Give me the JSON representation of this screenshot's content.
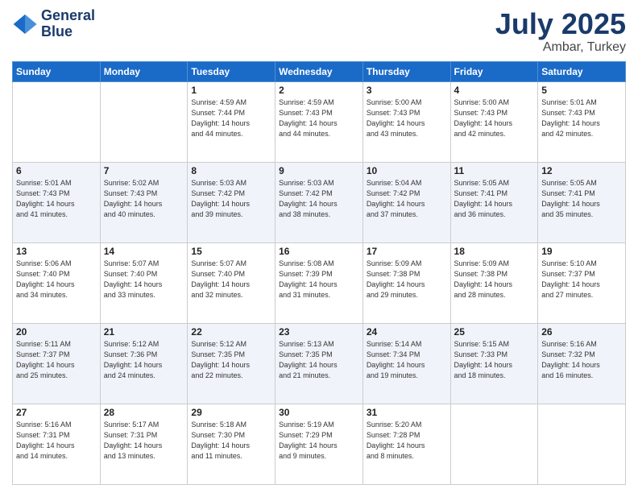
{
  "header": {
    "logo_line1": "General",
    "logo_line2": "Blue",
    "month": "July 2025",
    "location": "Ambar, Turkey"
  },
  "weekdays": [
    "Sunday",
    "Monday",
    "Tuesday",
    "Wednesday",
    "Thursday",
    "Friday",
    "Saturday"
  ],
  "weeks": [
    [
      {
        "day": "",
        "info": ""
      },
      {
        "day": "",
        "info": ""
      },
      {
        "day": "1",
        "info": "Sunrise: 4:59 AM\nSunset: 7:44 PM\nDaylight: 14 hours\nand 44 minutes."
      },
      {
        "day": "2",
        "info": "Sunrise: 4:59 AM\nSunset: 7:43 PM\nDaylight: 14 hours\nand 44 minutes."
      },
      {
        "day": "3",
        "info": "Sunrise: 5:00 AM\nSunset: 7:43 PM\nDaylight: 14 hours\nand 43 minutes."
      },
      {
        "day": "4",
        "info": "Sunrise: 5:00 AM\nSunset: 7:43 PM\nDaylight: 14 hours\nand 42 minutes."
      },
      {
        "day": "5",
        "info": "Sunrise: 5:01 AM\nSunset: 7:43 PM\nDaylight: 14 hours\nand 42 minutes."
      }
    ],
    [
      {
        "day": "6",
        "info": "Sunrise: 5:01 AM\nSunset: 7:43 PM\nDaylight: 14 hours\nand 41 minutes."
      },
      {
        "day": "7",
        "info": "Sunrise: 5:02 AM\nSunset: 7:43 PM\nDaylight: 14 hours\nand 40 minutes."
      },
      {
        "day": "8",
        "info": "Sunrise: 5:03 AM\nSunset: 7:42 PM\nDaylight: 14 hours\nand 39 minutes."
      },
      {
        "day": "9",
        "info": "Sunrise: 5:03 AM\nSunset: 7:42 PM\nDaylight: 14 hours\nand 38 minutes."
      },
      {
        "day": "10",
        "info": "Sunrise: 5:04 AM\nSunset: 7:42 PM\nDaylight: 14 hours\nand 37 minutes."
      },
      {
        "day": "11",
        "info": "Sunrise: 5:05 AM\nSunset: 7:41 PM\nDaylight: 14 hours\nand 36 minutes."
      },
      {
        "day": "12",
        "info": "Sunrise: 5:05 AM\nSunset: 7:41 PM\nDaylight: 14 hours\nand 35 minutes."
      }
    ],
    [
      {
        "day": "13",
        "info": "Sunrise: 5:06 AM\nSunset: 7:40 PM\nDaylight: 14 hours\nand 34 minutes."
      },
      {
        "day": "14",
        "info": "Sunrise: 5:07 AM\nSunset: 7:40 PM\nDaylight: 14 hours\nand 33 minutes."
      },
      {
        "day": "15",
        "info": "Sunrise: 5:07 AM\nSunset: 7:40 PM\nDaylight: 14 hours\nand 32 minutes."
      },
      {
        "day": "16",
        "info": "Sunrise: 5:08 AM\nSunset: 7:39 PM\nDaylight: 14 hours\nand 31 minutes."
      },
      {
        "day": "17",
        "info": "Sunrise: 5:09 AM\nSunset: 7:38 PM\nDaylight: 14 hours\nand 29 minutes."
      },
      {
        "day": "18",
        "info": "Sunrise: 5:09 AM\nSunset: 7:38 PM\nDaylight: 14 hours\nand 28 minutes."
      },
      {
        "day": "19",
        "info": "Sunrise: 5:10 AM\nSunset: 7:37 PM\nDaylight: 14 hours\nand 27 minutes."
      }
    ],
    [
      {
        "day": "20",
        "info": "Sunrise: 5:11 AM\nSunset: 7:37 PM\nDaylight: 14 hours\nand 25 minutes."
      },
      {
        "day": "21",
        "info": "Sunrise: 5:12 AM\nSunset: 7:36 PM\nDaylight: 14 hours\nand 24 minutes."
      },
      {
        "day": "22",
        "info": "Sunrise: 5:12 AM\nSunset: 7:35 PM\nDaylight: 14 hours\nand 22 minutes."
      },
      {
        "day": "23",
        "info": "Sunrise: 5:13 AM\nSunset: 7:35 PM\nDaylight: 14 hours\nand 21 minutes."
      },
      {
        "day": "24",
        "info": "Sunrise: 5:14 AM\nSunset: 7:34 PM\nDaylight: 14 hours\nand 19 minutes."
      },
      {
        "day": "25",
        "info": "Sunrise: 5:15 AM\nSunset: 7:33 PM\nDaylight: 14 hours\nand 18 minutes."
      },
      {
        "day": "26",
        "info": "Sunrise: 5:16 AM\nSunset: 7:32 PM\nDaylight: 14 hours\nand 16 minutes."
      }
    ],
    [
      {
        "day": "27",
        "info": "Sunrise: 5:16 AM\nSunset: 7:31 PM\nDaylight: 14 hours\nand 14 minutes."
      },
      {
        "day": "28",
        "info": "Sunrise: 5:17 AM\nSunset: 7:31 PM\nDaylight: 14 hours\nand 13 minutes."
      },
      {
        "day": "29",
        "info": "Sunrise: 5:18 AM\nSunset: 7:30 PM\nDaylight: 14 hours\nand 11 minutes."
      },
      {
        "day": "30",
        "info": "Sunrise: 5:19 AM\nSunset: 7:29 PM\nDaylight: 14 hours\nand 9 minutes."
      },
      {
        "day": "31",
        "info": "Sunrise: 5:20 AM\nSunset: 7:28 PM\nDaylight: 14 hours\nand 8 minutes."
      },
      {
        "day": "",
        "info": ""
      },
      {
        "day": "",
        "info": ""
      }
    ]
  ]
}
